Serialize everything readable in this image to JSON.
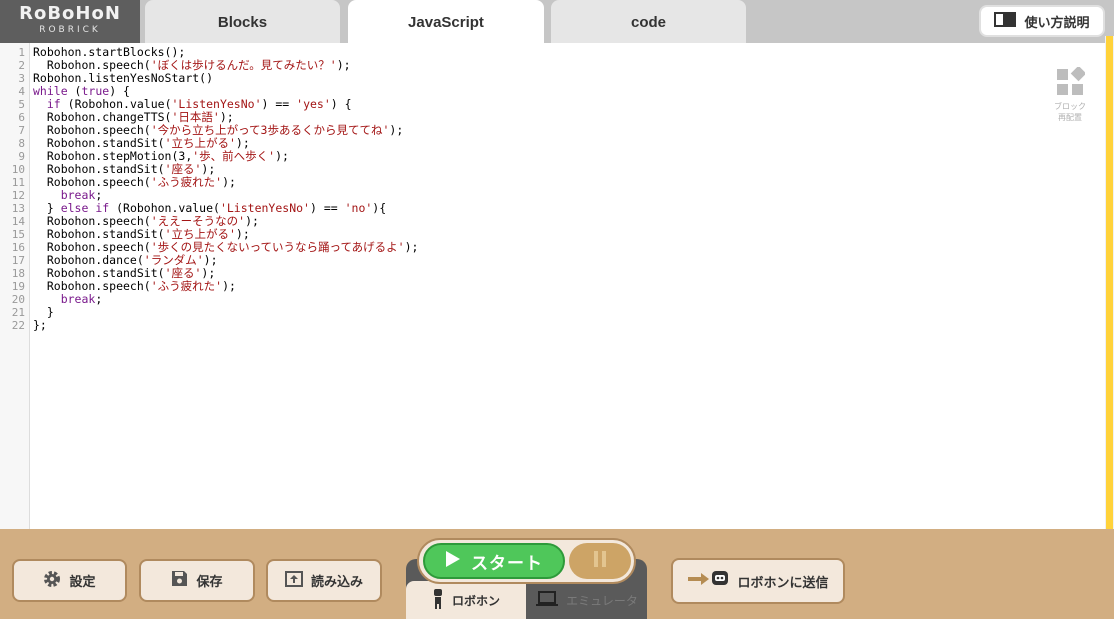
{
  "logo": {
    "main": "RoBoHoN",
    "sub": "ROBRICK"
  },
  "tabs": [
    {
      "label": "Blocks"
    },
    {
      "label": "JavaScript"
    },
    {
      "label": "code"
    }
  ],
  "help": {
    "label": "使い方説明",
    "icon": "book-icon"
  },
  "arrange": {
    "label_line1": "ブロック",
    "label_line2": "再配置",
    "icon": "block-arrange-icon"
  },
  "code_lines": [
    [
      {
        "t": "Robohon.startBlocks();"
      }
    ],
    [
      {
        "t": "  Robohon.speech("
      },
      {
        "t": "'ぼくは歩けるんだ。見てみたい？'",
        "c": "str"
      },
      {
        "t": ");"
      }
    ],
    [
      {
        "t": "Robohon.listenYesNoStart()"
      }
    ],
    [
      {
        "t": "while",
        "c": "kw"
      },
      {
        "t": " ("
      },
      {
        "t": "true",
        "c": "kw"
      },
      {
        "t": ") {"
      }
    ],
    [
      {
        "t": "  "
      },
      {
        "t": "if",
        "c": "kw"
      },
      {
        "t": " (Robohon.value("
      },
      {
        "t": "'ListenYesNo'",
        "c": "str"
      },
      {
        "t": ") == "
      },
      {
        "t": "'yes'",
        "c": "str"
      },
      {
        "t": ") {"
      }
    ],
    [
      {
        "t": "  Robohon.changeTTS("
      },
      {
        "t": "'日本語'",
        "c": "str"
      },
      {
        "t": ");"
      }
    ],
    [
      {
        "t": "  Robohon.speech("
      },
      {
        "t": "'今から立ち上がって3歩あるくから見ててね'",
        "c": "str"
      },
      {
        "t": ");"
      }
    ],
    [
      {
        "t": "  Robohon.standSit("
      },
      {
        "t": "'立ち上がる'",
        "c": "str"
      },
      {
        "t": ");"
      }
    ],
    [
      {
        "t": "  Robohon.stepMotion(3,"
      },
      {
        "t": "'歩、前へ歩く'",
        "c": "str"
      },
      {
        "t": ");"
      }
    ],
    [
      {
        "t": "  Robohon.standSit("
      },
      {
        "t": "'座る'",
        "c": "str"
      },
      {
        "t": ");"
      }
    ],
    [
      {
        "t": "  Robohon.speech("
      },
      {
        "t": "'ふう疲れた'",
        "c": "str"
      },
      {
        "t": ");"
      }
    ],
    [
      {
        "t": "    "
      },
      {
        "t": "break",
        "c": "kw"
      },
      {
        "t": ";"
      }
    ],
    [
      {
        "t": "  } "
      },
      {
        "t": "else if",
        "c": "kw"
      },
      {
        "t": " (Robohon.value("
      },
      {
        "t": "'ListenYesNo'",
        "c": "str"
      },
      {
        "t": ") == "
      },
      {
        "t": "'no'",
        "c": "str"
      },
      {
        "t": "){"
      }
    ],
    [
      {
        "t": "  Robohon.speech("
      },
      {
        "t": "'ええーそうなの'",
        "c": "str"
      },
      {
        "t": ");"
      }
    ],
    [
      {
        "t": "  Robohon.standSit("
      },
      {
        "t": "'立ち上がる'",
        "c": "str"
      },
      {
        "t": ");"
      }
    ],
    [
      {
        "t": "  Robohon.speech("
      },
      {
        "t": "'歩くの見たくないっていうなら踊ってあげるよ'",
        "c": "str"
      },
      {
        "t": ");"
      }
    ],
    [
      {
        "t": "  Robohon.dance("
      },
      {
        "t": "'ランダム'",
        "c": "str"
      },
      {
        "t": ");"
      }
    ],
    [
      {
        "t": "  Robohon.standSit("
      },
      {
        "t": "'座る'",
        "c": "str"
      },
      {
        "t": ");"
      }
    ],
    [
      {
        "t": "  Robohon.speech("
      },
      {
        "t": "'ふう疲れた'",
        "c": "str"
      },
      {
        "t": ");"
      }
    ],
    [
      {
        "t": "    "
      },
      {
        "t": "break",
        "c": "kw"
      },
      {
        "t": ";"
      }
    ],
    [
      {
        "t": "  }"
      }
    ],
    [
      {
        "t": "};"
      }
    ]
  ],
  "bottom": {
    "settings": {
      "label": "設定",
      "icon": "gear-icon"
    },
    "save": {
      "label": "保存",
      "icon": "save-icon"
    },
    "load": {
      "label": "読み込み",
      "icon": "upload-icon"
    },
    "start": {
      "label": "スタート",
      "icon": "play-icon"
    },
    "pause": {
      "icon": "pause-icon"
    },
    "mode_robot": {
      "label": "ロボホン",
      "icon": "robot-icon"
    },
    "mode_emulator": {
      "label": "エミュレータ",
      "icon": "laptop-icon"
    },
    "send": {
      "label": "ロボホンに送信",
      "icon": "robot-send-icon"
    }
  },
  "colors": {
    "bottom_bar": "#d2ae82",
    "start_green": "#4fc75a",
    "keyword": "#7a1a8c",
    "string": "#a31515"
  }
}
